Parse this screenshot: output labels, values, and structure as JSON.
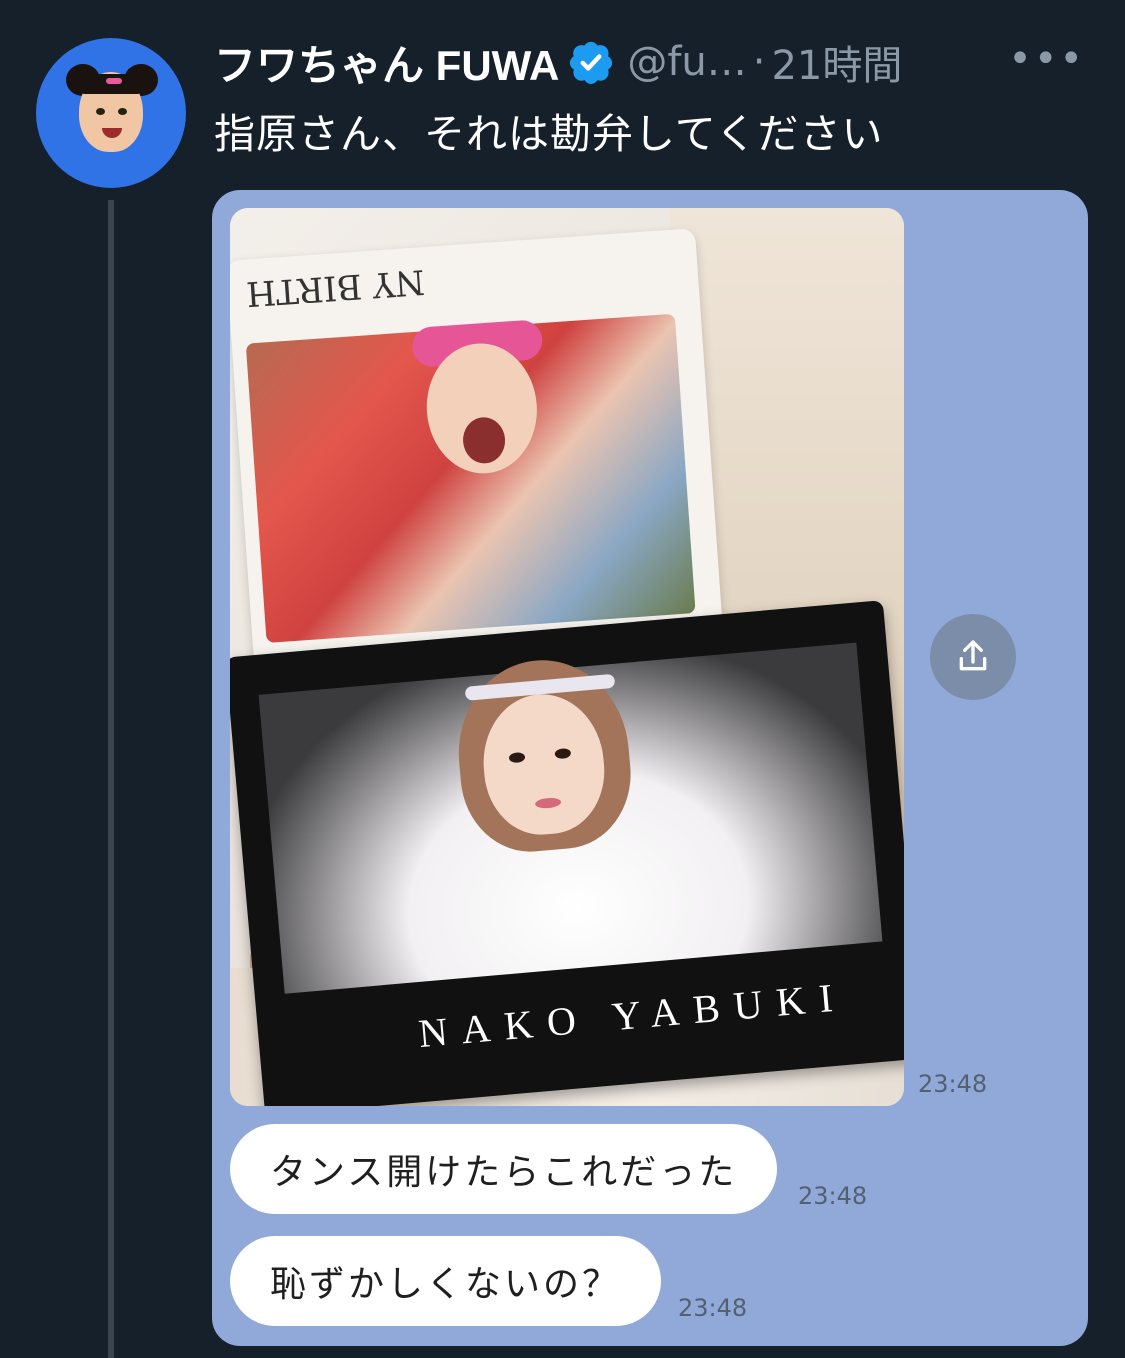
{
  "tweet": {
    "display_name": "フワちゃん FUWA",
    "handle": "@fu…",
    "separator": "·",
    "time_ago": "21時間",
    "more": "•••",
    "text": "指原さん、それは勘弁してください"
  },
  "media": {
    "photo_shirt_top_text": "NY BIRTH",
    "photo_shirt_bottom_text": "NAKO YABUKI",
    "photo_timestamp": "23:48",
    "messages": [
      {
        "text": "タンス開けたらこれだった",
        "timestamp": "23:48"
      },
      {
        "text": "恥ずかしくないの？",
        "timestamp": "23:48"
      }
    ]
  },
  "colors": {
    "background": "#15202b",
    "verified": "#1d9bf0",
    "chat_bg": "#90a9d8"
  },
  "icons": [
    "verified-badge-icon",
    "more-icon",
    "share-icon"
  ]
}
